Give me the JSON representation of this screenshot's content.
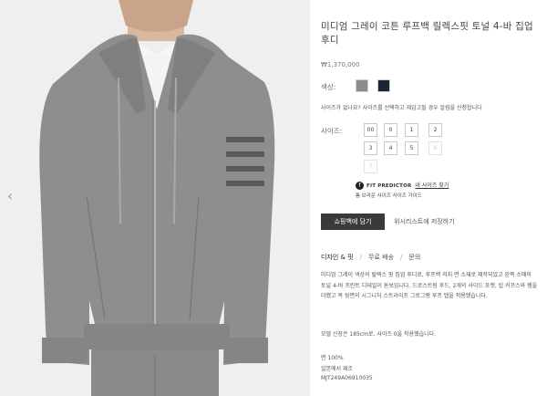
{
  "product": {
    "title": "미디엄 그레이 코튼 루프백 릴렉스핏 토널 4-바 집업 후디",
    "price": "₩1,370,000",
    "image_alt": "Medium grey cotton loopback relaxed-fit tonal 4-bar zip-up hoodie",
    "colors": [
      {
        "name": "gray",
        "hex": "#8c8c8c",
        "selected": true
      },
      {
        "name": "navy",
        "hex": "#1b2536",
        "selected": false
      }
    ]
  },
  "labels": {
    "color": "색상:",
    "size": "사이즈:",
    "size_notice": "사이즈가 없나요? 사이즈를 선택하고 재입고될 경우 알림을 신청합니다",
    "fit_logo": "FIT PREDICTOR",
    "fit_link": "내 사이즈 찾기",
    "size_guide_prefix": "톰 브라운",
    "size_guide_link": "사이즈 사이즈 가이드",
    "cart_button": "쇼핑백에 담기",
    "wishlist": "위시리스트에 저장하기"
  },
  "sizes": [
    {
      "label": "00",
      "available": true
    },
    {
      "label": "0",
      "available": true
    },
    {
      "label": "1",
      "available": true
    },
    {
      "label": "2",
      "available": true
    },
    {
      "label": "3",
      "available": true
    },
    {
      "label": "4",
      "available": true
    },
    {
      "label": "5",
      "available": true
    },
    {
      "label": "6",
      "available": false
    },
    {
      "label": "7",
      "available": false
    }
  ],
  "tabs": [
    {
      "label": "디자인 & 핏",
      "active": true
    },
    {
      "label": "무료 배송",
      "active": false
    },
    {
      "label": "문의",
      "active": false
    }
  ],
  "description": "미디엄 그레이 색상의 릴렉스 핏 집업 후디로, 루프백 저지 면 소재로 제작되었고 왼쪽 소매의 토널 4-바 프린트 디테일이 돋보입니다. 드로스트링 후드, 2개의 사이드 포켓, 립 커프스와 헴을 더했고 목 뒷면의 시그니처 스트라이프 그로그랭 루프 탭을 적용했습니다.",
  "model_info": "모델 신장은 185cm로, 사이즈 0을 착용했습니다.",
  "composition": "면 100%",
  "origin": "일본에서 제조",
  "sku": "MJT249A06910035",
  "icons": {
    "prev": "‹",
    "fit": "f"
  },
  "colors": {
    "image_bg": "#eeeeee",
    "hoodie": "#8e8e8e",
    "cart_button_bg": "#3a3a3a"
  }
}
